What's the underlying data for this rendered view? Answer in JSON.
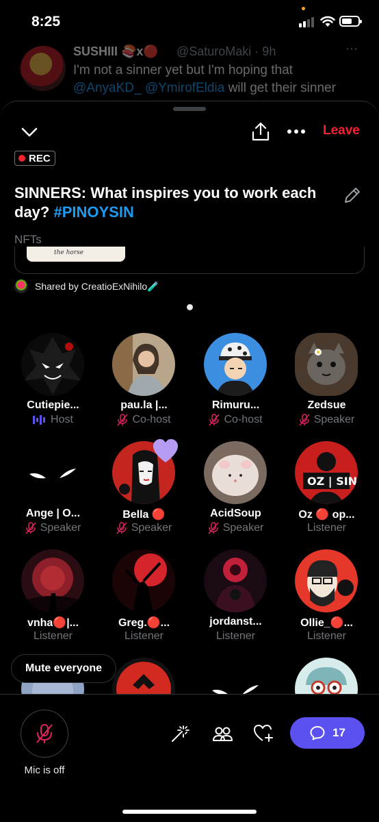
{
  "status_bar": {
    "time": "8:25"
  },
  "background_tweet": {
    "name": "SUSHIII 🍣x🔴",
    "handle": "@SaturoMaki · 9h",
    "text_before": "I'm not a sinner yet but I'm hoping that",
    "mention_1": "@AnyaKD_",
    "mention_2": "@YmirofEldia",
    "text_after": "will get their sinner"
  },
  "header": {
    "leave_label": "Leave",
    "rec_label": "REC",
    "title": "SINNERS: What inspires you to work each day?",
    "hashtag": "#PINOYSIN",
    "topic": "NFTs",
    "shared_thumb_text": "the horse",
    "shared_by": "Shared by CreatioExNihilo",
    "shared_by_emoji": "🧪"
  },
  "participants": [
    {
      "name": "Cutiepie...",
      "role": "Host",
      "icon": "host-bars-icon"
    },
    {
      "name": "pau.la |...",
      "role": "Co-host",
      "icon": "mic-off-icon"
    },
    {
      "name": "Rimuru...",
      "role": "Co-host",
      "icon": "mic-off-icon"
    },
    {
      "name": "Zedsue",
      "role": "Speaker",
      "icon": "mic-off-icon"
    },
    {
      "name": "Ange | O...",
      "role": "Speaker",
      "icon": "mic-off-icon"
    },
    {
      "name": "Bella 🔴",
      "role": "Speaker",
      "icon": "mic-off-icon",
      "reaction": "purple-heart-icon"
    },
    {
      "name": "AcidSoup",
      "role": "Speaker",
      "icon": "mic-off-icon"
    },
    {
      "name": "Oz 🔴 op...",
      "role": "Listener"
    },
    {
      "name": "vnha🔴|...",
      "role": "Listener"
    },
    {
      "name": "Greg.🔴...",
      "role": "Listener"
    },
    {
      "name": "jordanst...",
      "role": "Listener"
    },
    {
      "name": "Ollie_🔴...",
      "role": "Listener"
    }
  ],
  "mute_everyone_label": "Mute everyone",
  "bottom_bar": {
    "mic_label": "Mic is off",
    "comment_count": "17"
  },
  "colors": {
    "accent_blue": "#1d9bf0",
    "leave_red": "#f4212e",
    "host_purple": "#5b51f0",
    "heart_purple": "#b69cf2"
  }
}
